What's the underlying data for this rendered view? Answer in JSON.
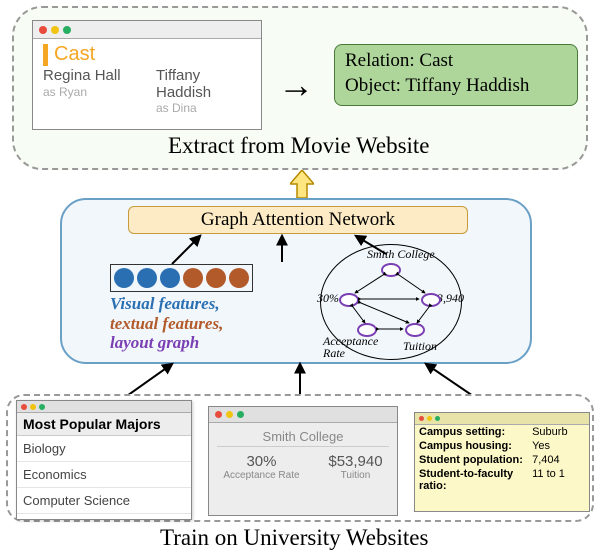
{
  "top": {
    "caption": "Extract from Movie Website",
    "cast": {
      "heading": "Cast",
      "actor1_name": "Regina Hall",
      "actor1_role": "as Ryan",
      "actor2_name": "Tiffany Haddish",
      "actor2_role": "as Dina"
    },
    "relation_line1": "Relation: Cast",
    "relation_line2": "Object: Tiffany Haddish"
  },
  "middle": {
    "gan_label": "Graph Attention Network",
    "features_line1": "Visual features,",
    "features_line2": "textual features,",
    "features_line3": "layout graph",
    "graph": {
      "node_top": "Smith College",
      "node_left": "30%",
      "node_right": "$53,940",
      "node_bl": "Acceptance Rate",
      "node_br": "Tuition"
    }
  },
  "bottom": {
    "caption": "Train on University Websites",
    "majors": {
      "heading": "Most Popular Majors",
      "row1": "Biology",
      "row2": "Economics",
      "row3": "Computer Science"
    },
    "smith": {
      "name": "Smith College",
      "stat1_val": "30%",
      "stat1_lab": "Acceptance Rate",
      "stat2_val": "$53,940",
      "stat2_lab": "Tuition"
    },
    "campus": {
      "r1k": "Campus setting:",
      "r1v": "Suburb",
      "r2k": "Campus housing:",
      "r2v": "Yes",
      "r3k": "Student population:",
      "r3v": "7,404",
      "r4k": "Student-to-faculty ratio:",
      "r4v": "11 to 1"
    }
  }
}
